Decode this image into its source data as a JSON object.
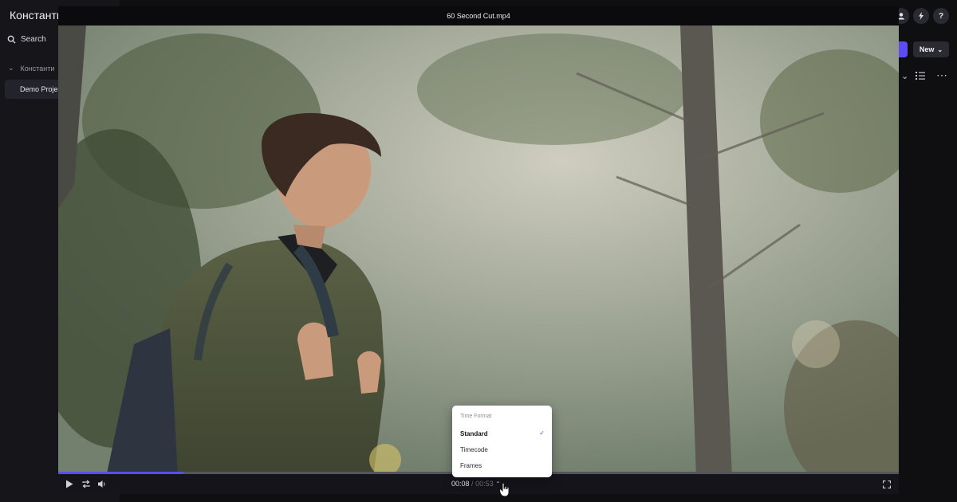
{
  "workspace": {
    "title": "Константи",
    "search_label": "Search",
    "team_label": "Константи",
    "project_label": "Demo Proje"
  },
  "header": {
    "icons": [
      "user-icon",
      "lightning-icon",
      "help-icon"
    ],
    "help_glyph": "?",
    "new_label": "New"
  },
  "player": {
    "title": "60 Second Cut.mp4",
    "current_time": "00:08",
    "duration": "00:53",
    "separator": "/",
    "progress_fraction": 0.149
  },
  "time_format_menu": {
    "heading": "Time Format",
    "options": [
      "Standard",
      "Timecode",
      "Frames"
    ],
    "selected": "Standard"
  },
  "colors": {
    "accent": "#5b4df2",
    "background": "#0f0f12"
  }
}
